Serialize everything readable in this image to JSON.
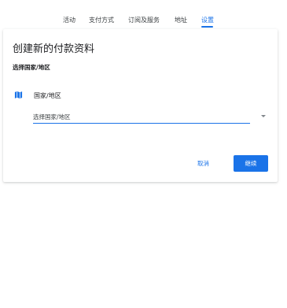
{
  "tabs": [
    {
      "label": "活动"
    },
    {
      "label": "支付方式"
    },
    {
      "label": "订阅及服务"
    },
    {
      "label": "地址"
    },
    {
      "label": "设置"
    }
  ],
  "active_tab": "设置",
  "card": {
    "title": "创建新的付款资料",
    "section_label": "选择国家/地区",
    "field": {
      "icon": "map-icon",
      "label": "国家/地区",
      "select_value": "选择国家/地区"
    },
    "buttons": {
      "cancel": "取消",
      "continue": "继续"
    }
  },
  "colors": {
    "accent": "#1a73e8",
    "text_primary": "#202124",
    "text_secondary": "#3c4043"
  }
}
